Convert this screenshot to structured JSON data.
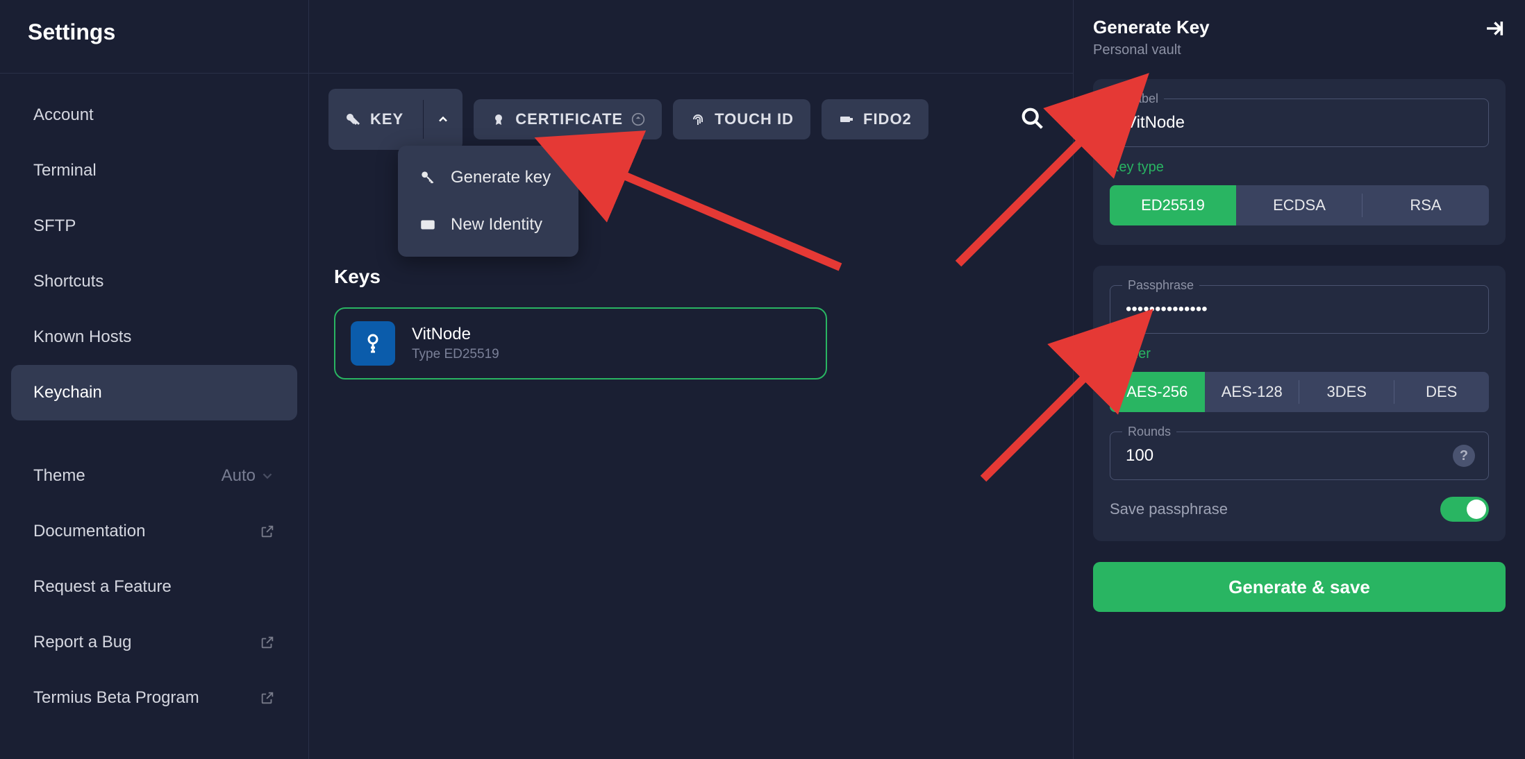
{
  "sidebar": {
    "title": "Settings",
    "items": [
      {
        "label": "Account"
      },
      {
        "label": "Terminal"
      },
      {
        "label": "SFTP"
      },
      {
        "label": "Shortcuts"
      },
      {
        "label": "Known Hosts"
      },
      {
        "label": "Keychain"
      }
    ],
    "secondary": [
      {
        "label": "Theme",
        "value": "Auto"
      },
      {
        "label": "Documentation"
      },
      {
        "label": "Request a Feature"
      },
      {
        "label": "Report a Bug"
      },
      {
        "label": "Termius Beta Program"
      }
    ]
  },
  "toolbar": {
    "key": "KEY",
    "certificate": "CERTIFICATE",
    "touchid": "TOUCH ID",
    "fido2": "FIDO2"
  },
  "dropdown": {
    "generate": "Generate key",
    "identity": "New Identity"
  },
  "keys": {
    "heading": "Keys",
    "item": {
      "name": "VitNode",
      "type": "Type ED25519"
    }
  },
  "panel": {
    "title": "Generate Key",
    "subtitle": "Personal vault",
    "label_field": "Label",
    "label_value": "VitNode",
    "keytype_label": "Key type",
    "keytypes": [
      "ED25519",
      "ECDSA",
      "RSA"
    ],
    "passphrase_field": "Passphrase",
    "passphrase_value": "••••••••••••••",
    "cipher_label": "Cipher",
    "ciphers": [
      "AES-256",
      "AES-128",
      "3DES",
      "DES"
    ],
    "rounds_field": "Rounds",
    "rounds_value": "100",
    "save_pass": "Save passphrase",
    "submit": "Generate & save"
  }
}
